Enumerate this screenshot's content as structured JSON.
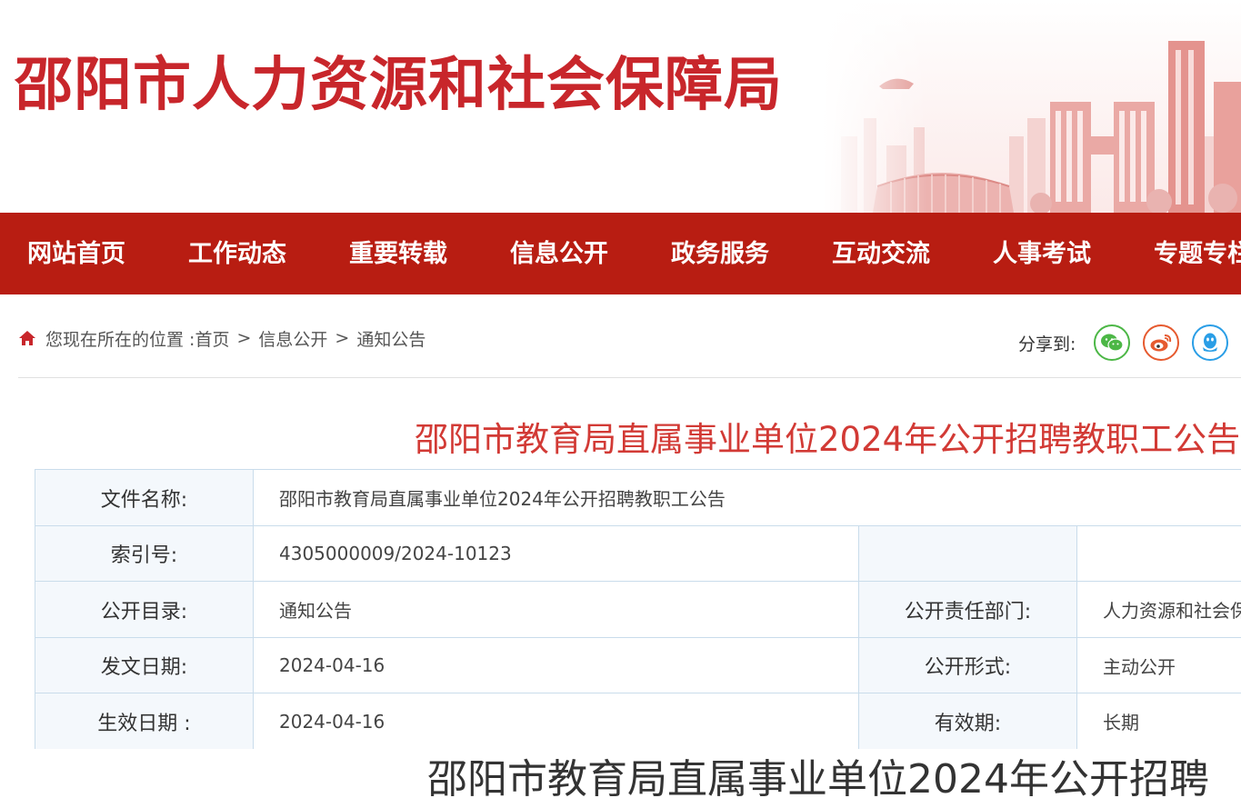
{
  "site": {
    "title": "邵阳市人力资源和社会保障局"
  },
  "nav": {
    "items": [
      {
        "label": "网站首页"
      },
      {
        "label": "工作动态"
      },
      {
        "label": "重要转载"
      },
      {
        "label": "信息公开"
      },
      {
        "label": "政务服务"
      },
      {
        "label": "互动交流"
      },
      {
        "label": "人事考试"
      },
      {
        "label": "专题专栏"
      }
    ]
  },
  "breadcrumb": {
    "prefix": "您现在所在的位置 : ",
    "items": [
      "首页",
      "信息公开",
      "通知公告"
    ],
    "separator": ">"
  },
  "share": {
    "label": "分享到:",
    "buttons": [
      {
        "icon": "wechat-icon",
        "color": "#4cb746"
      },
      {
        "icon": "weibo-icon",
        "color": "#e65a2f"
      },
      {
        "icon": "qq-icon",
        "color": "#2a9ee6"
      }
    ]
  },
  "article": {
    "title": "邵阳市教育局直属事业单位2024年公开招聘教职工公告",
    "heading": "邵阳市教育局直属事业单位2024年公开招聘"
  },
  "meta": {
    "file_name_label": "文件名称:",
    "file_name_value": "邵阳市教育局直属事业单位2024年公开招聘教职工公告",
    "index_label": "索引号:",
    "index_value": "4305000009/2024-10123",
    "index_extra_label": "",
    "index_extra_value": "",
    "catalog_label": "公开目录:",
    "catalog_value": "通知公告",
    "dept_label": "公开责任部门:",
    "dept_value": "人力资源和社会保障局",
    "issue_date_label": "发文日期:",
    "issue_date_value": "2024-04-16",
    "form_label": "公开形式:",
    "form_value": "主动公开",
    "effective_label": "生效日期 :",
    "effective_value": "2024-04-16",
    "validity_label": "有效期:",
    "validity_value": "长期"
  },
  "colors": {
    "brand_red": "#c8262b",
    "nav_red": "#b81d12",
    "title_red": "#d23a35",
    "table_border": "#c9dceb",
    "table_label_bg": "#f4f8fc"
  }
}
